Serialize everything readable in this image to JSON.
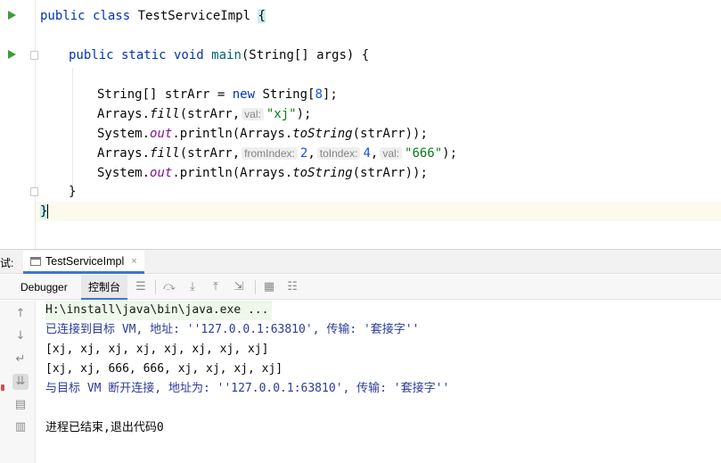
{
  "editor": {
    "lines": {
      "class_decl": {
        "kw": "public class ",
        "name": "TestServiceImpl ",
        "brace": "{"
      },
      "main_decl": {
        "kw": "public static void ",
        "name": "main",
        "params": "(String[] args) {"
      },
      "line1": {
        "a": "String[] strArr = ",
        "new": "new",
        "b": " String[",
        "num": "8",
        "c": "];"
      },
      "line2": {
        "a": "Arrays.",
        "fn": "fill",
        "b": "(strArr,",
        "hint": "val:",
        "str": "\"xj\"",
        "c": ");"
      },
      "line3": {
        "a": "System.",
        "fld": "out",
        "b": ".println(Arrays.",
        "fn": "toString",
        "c": "(strArr));"
      },
      "line4": {
        "a": "Arrays.",
        "fn": "fill",
        "b": "(strArr,",
        "hint1": "fromIndex:",
        "n1": "2",
        "sep1": ",",
        "hint2": "toIndex:",
        "n2": "4",
        "sep2": ",",
        "hint3": "val:",
        "str": "\"666\"",
        "c": ");"
      },
      "line5": {
        "a": "System.",
        "fld": "out",
        "b": ".println(Arrays.",
        "fn": "toString",
        "c": "(strArr));"
      },
      "close_method": "}",
      "close_class": "}"
    }
  },
  "toolwindow": {
    "title": "试:",
    "run_tab": {
      "label": "TestServiceImpl",
      "close": "×"
    },
    "tabs": {
      "debugger": "Debugger",
      "console": "控制台"
    },
    "console_lines": {
      "cmd": "H:\\install\\java\\bin\\java.exe ...",
      "connected": "已连接到目标 VM, 地址: ''127.0.0.1:63810', 传输: '套接字''",
      "out1": "[xj, xj, xj, xj, xj, xj, xj, xj]",
      "out2": "[xj, xj, 666, 666, xj, xj, xj, xj]",
      "disconnected": "与目标 VM 断开连接, 地址为: ''127.0.0.1:63810', 传输: '套接字''",
      "exit": "进程已结束,退出代码0"
    }
  },
  "colors": {
    "keyword": "#0033b3",
    "string": "#067d17",
    "number": "#1750eb",
    "run_icon": "#3f9c35",
    "tab_underline": "#3d75d1"
  }
}
